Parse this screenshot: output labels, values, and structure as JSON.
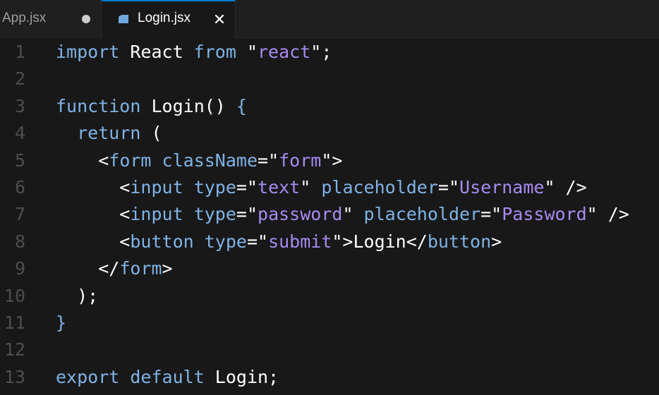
{
  "tabs": [
    {
      "label": "App.jsx",
      "modified": true
    },
    {
      "label": "Login.jsx",
      "active": true,
      "icon": "react-file-icon"
    }
  ],
  "colors": {
    "keyword": "#7fb3e6",
    "string_value": "#a78bf0",
    "text": "#ffffff",
    "line_number": "#4d4d4d",
    "background": "#181818",
    "active_tab_border": "#0078d4"
  },
  "editor": {
    "line_numbers": [
      "1",
      "2",
      "3",
      "4",
      "5",
      "6",
      "7",
      "8",
      "9",
      "10",
      "11",
      "12",
      "13"
    ],
    "lines": [
      {
        "tokens": [
          [
            "kw",
            "import"
          ],
          [
            "plain",
            " React "
          ],
          [
            "kw",
            "from"
          ],
          [
            "plain",
            " \""
          ],
          [
            "strv",
            "react"
          ],
          [
            "plain",
            "\";"
          ]
        ]
      },
      {
        "tokens": []
      },
      {
        "tokens": [
          [
            "kw",
            "function"
          ],
          [
            "plain",
            " "
          ],
          [
            "fn",
            "Login"
          ],
          [
            "plain",
            "() "
          ],
          [
            "kw",
            "{"
          ]
        ]
      },
      {
        "tokens": [
          [
            "plain",
            "  "
          ],
          [
            "kw",
            "return"
          ],
          [
            "plain",
            " ("
          ]
        ]
      },
      {
        "tokens": [
          [
            "plain",
            "    <"
          ],
          [
            "tag",
            "form"
          ],
          [
            "plain",
            " "
          ],
          [
            "attr",
            "className"
          ],
          [
            "plain",
            "=\""
          ],
          [
            "strv",
            "form"
          ],
          [
            "plain",
            "\">"
          ]
        ]
      },
      {
        "tokens": [
          [
            "plain",
            "      <"
          ],
          [
            "tag",
            "input"
          ],
          [
            "plain",
            " "
          ],
          [
            "attr",
            "type"
          ],
          [
            "plain",
            "=\""
          ],
          [
            "strv",
            "text"
          ],
          [
            "plain",
            "\" "
          ],
          [
            "attr",
            "placeholder"
          ],
          [
            "plain",
            "=\""
          ],
          [
            "strv",
            "Username"
          ],
          [
            "plain",
            "\" />"
          ]
        ]
      },
      {
        "tokens": [
          [
            "plain",
            "      <"
          ],
          [
            "tag",
            "input"
          ],
          [
            "plain",
            " "
          ],
          [
            "attr",
            "type"
          ],
          [
            "plain",
            "=\""
          ],
          [
            "strv",
            "password"
          ],
          [
            "plain",
            "\" "
          ],
          [
            "attr",
            "placeholder"
          ],
          [
            "plain",
            "=\""
          ],
          [
            "strv",
            "Password"
          ],
          [
            "plain",
            "\" />"
          ]
        ]
      },
      {
        "tokens": [
          [
            "plain",
            "      <"
          ],
          [
            "tag",
            "button"
          ],
          [
            "plain",
            " "
          ],
          [
            "attr",
            "type"
          ],
          [
            "plain",
            "=\""
          ],
          [
            "strv",
            "submit"
          ],
          [
            "plain",
            "\">Login</"
          ],
          [
            "tag",
            "button"
          ],
          [
            "plain",
            ">"
          ]
        ]
      },
      {
        "tokens": [
          [
            "plain",
            "    </"
          ],
          [
            "tag",
            "form"
          ],
          [
            "plain",
            ">"
          ]
        ]
      },
      {
        "tokens": [
          [
            "plain",
            "  );"
          ]
        ]
      },
      {
        "tokens": [
          [
            "kw",
            "}"
          ]
        ]
      },
      {
        "tokens": []
      },
      {
        "tokens": [
          [
            "kw",
            "export"
          ],
          [
            "plain",
            " "
          ],
          [
            "kw",
            "default"
          ],
          [
            "plain",
            " Login;"
          ]
        ]
      }
    ]
  }
}
